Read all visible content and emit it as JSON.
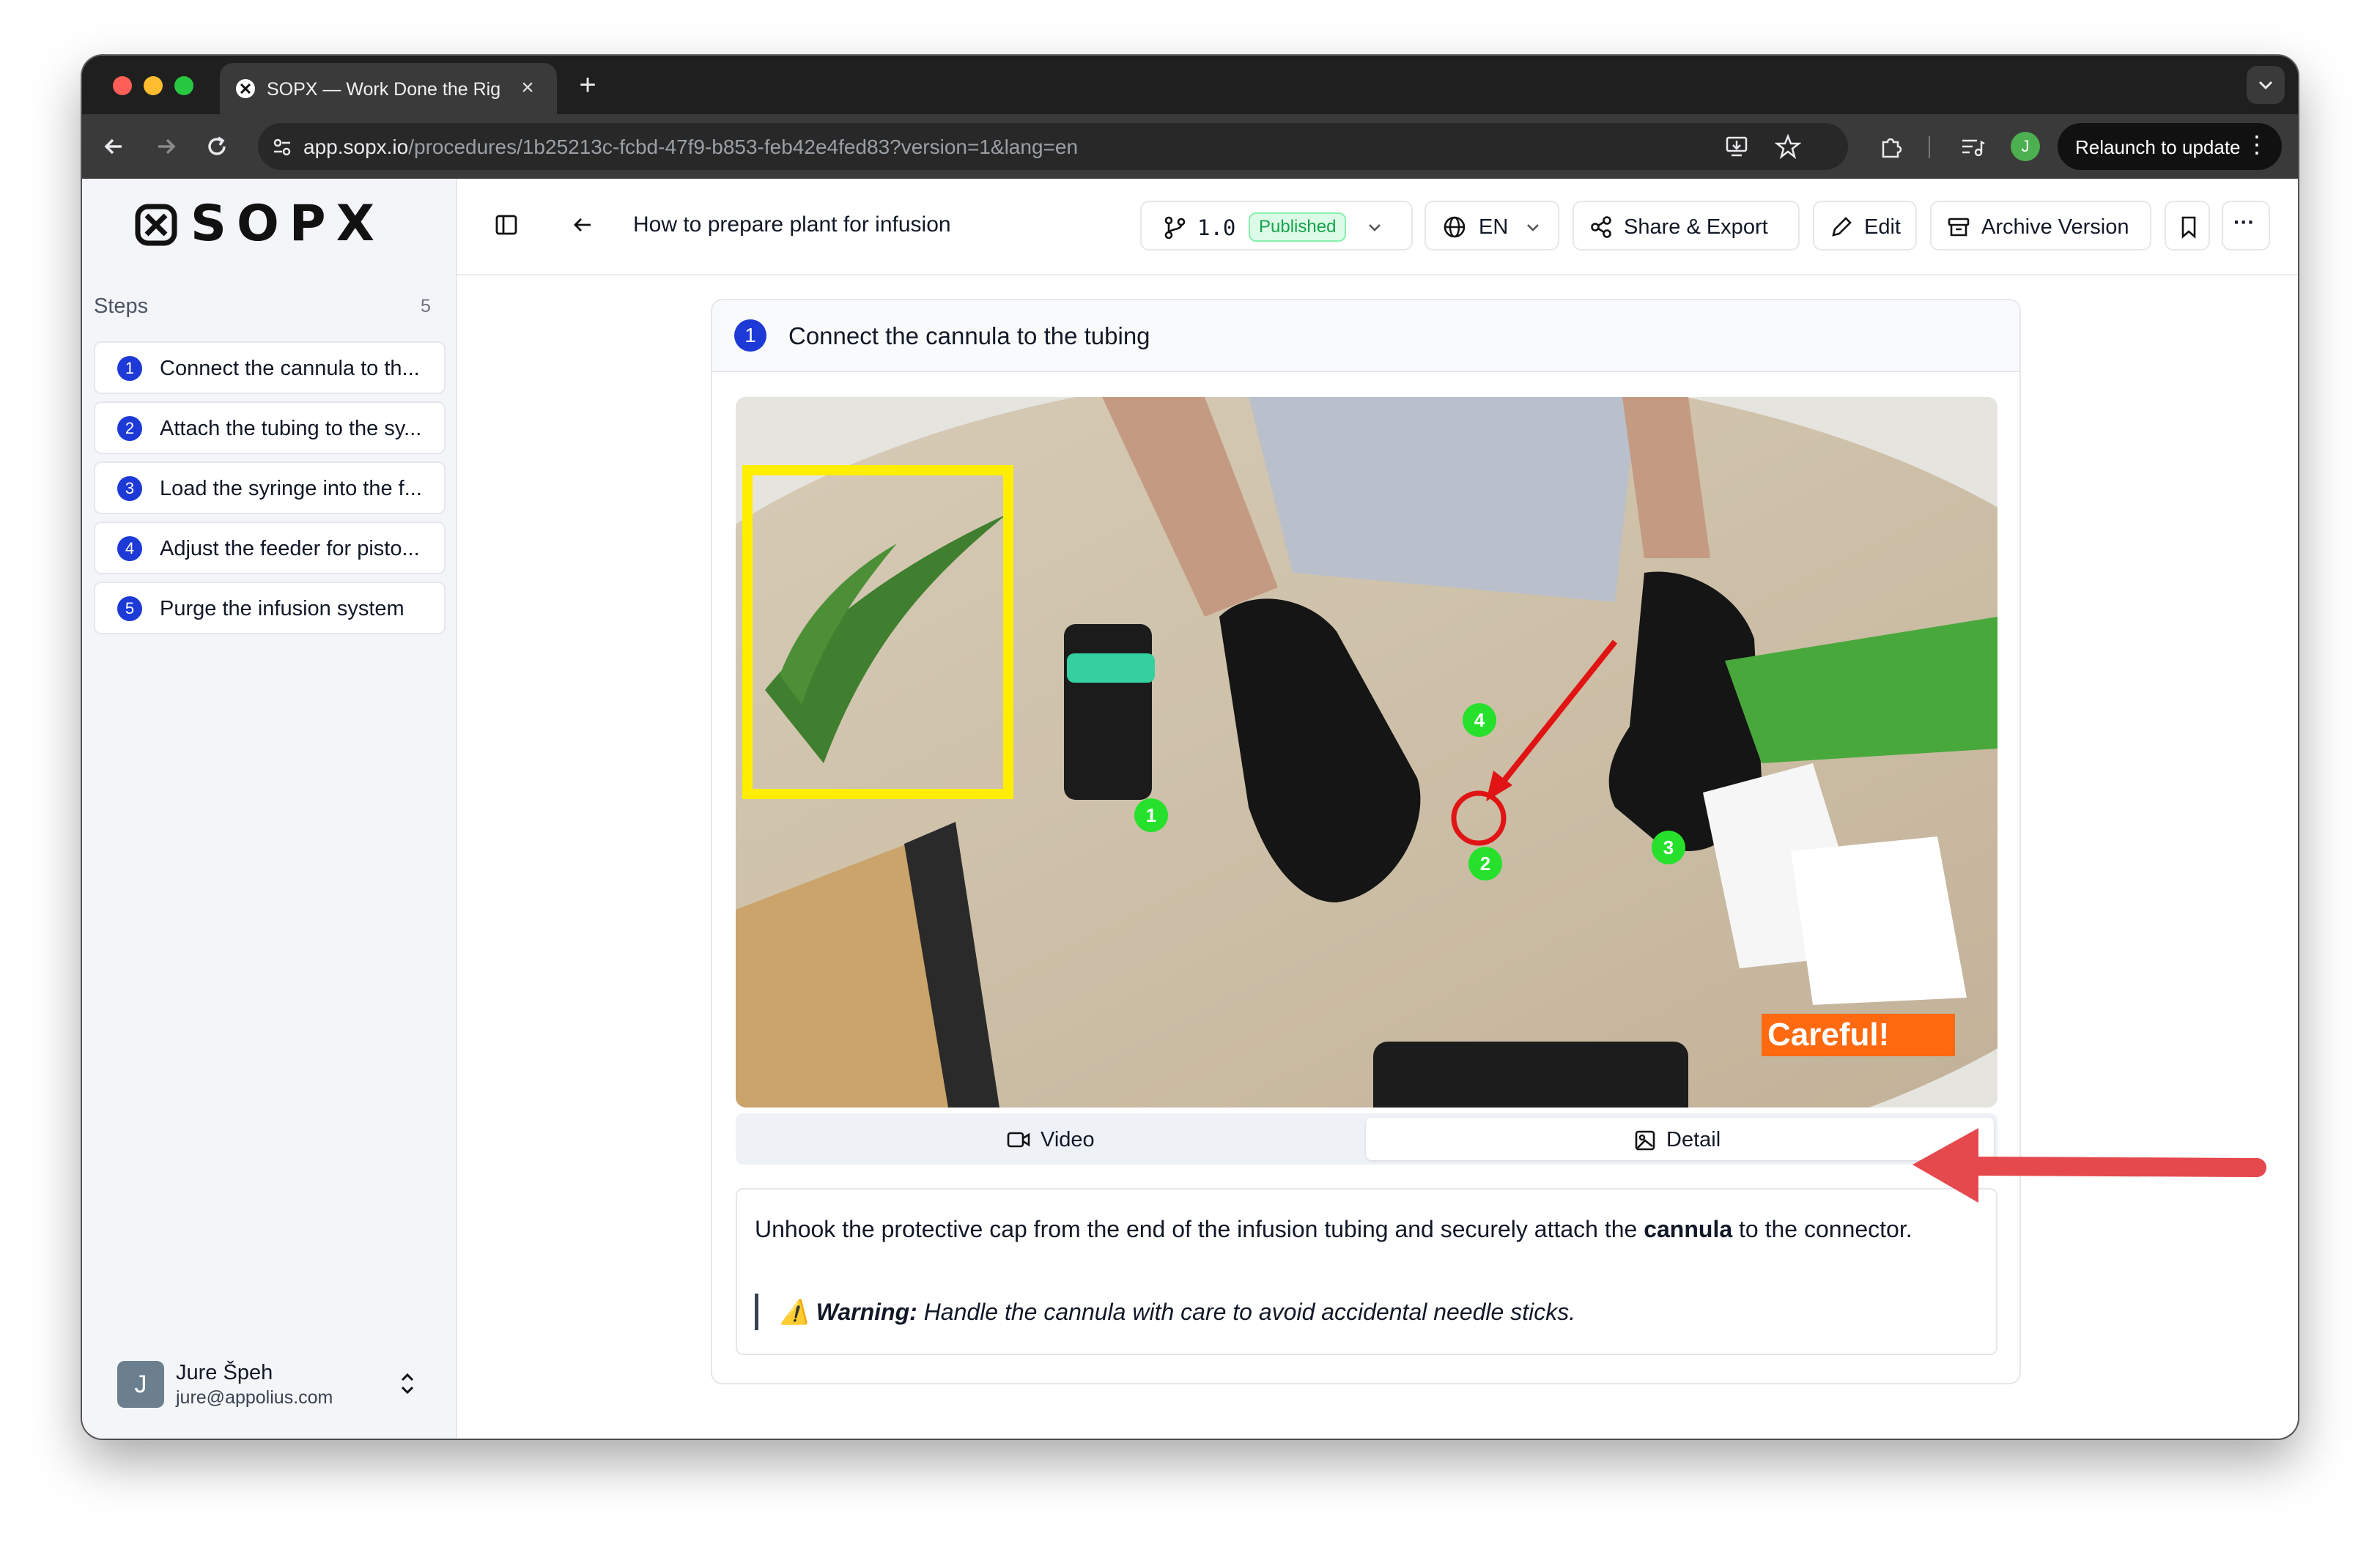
{
  "browser": {
    "tab_title": "SOPX — Work Done the Right Way",
    "tab_close": "×",
    "new_tab": "+",
    "url_host": "app.sopx.io",
    "url_path": "/procedures/1b25213c-fcbd-47f9-b853-feb42e4fed83?version=1&lang=en",
    "profile_initial": "J",
    "relaunch_label": "Relaunch to update",
    "menu_dots": "⋮"
  },
  "sidebar": {
    "logo_text": "SOPX",
    "steps_heading": "Steps",
    "steps_count": "5",
    "steps": [
      {
        "num": "1",
        "label": "Connect the cannula to th..."
      },
      {
        "num": "2",
        "label": "Attach the tubing to the sy..."
      },
      {
        "num": "3",
        "label": "Load the syringe into the f..."
      },
      {
        "num": "4",
        "label": "Adjust the feeder for pisto..."
      },
      {
        "num": "5",
        "label": "Purge the infusion system"
      }
    ],
    "user": {
      "initial": "J",
      "name": "Jure Špeh",
      "email": "jure@appolius.com"
    }
  },
  "header": {
    "procedure_title": "How to prepare plant for infusion",
    "version": "1.0",
    "status": "Published",
    "language": "EN",
    "share_label": "Share & Export",
    "edit_label": "Edit",
    "archive_label": "Archive Version",
    "more_label": "···"
  },
  "step": {
    "number": "1",
    "title": "Connect the cannula to the tubing",
    "image_overlay_text": "Careful!",
    "markers": [
      "1",
      "2",
      "3",
      "4"
    ],
    "tabs": {
      "video_label": "Video",
      "detail_label": "Detail"
    },
    "description_pre": "Unhook the protective cap from the end of the infusion tubing and securely attach the ",
    "description_bold": "cannula",
    "description_post": " to the connector.",
    "warning_icon": "⚠️",
    "warning_label": "Warning:",
    "warning_text": " Handle the cannula with care to avoid accidental needle sticks."
  },
  "colors": {
    "accent": "#1d39d6",
    "published_bg": "#dcfce7",
    "published_text": "#16a34a",
    "callout_arrow": "#e5484d",
    "overlay_orange": "#ff6a10",
    "highlight_yellow": "#ffee00",
    "marker_green": "#26e02c"
  }
}
